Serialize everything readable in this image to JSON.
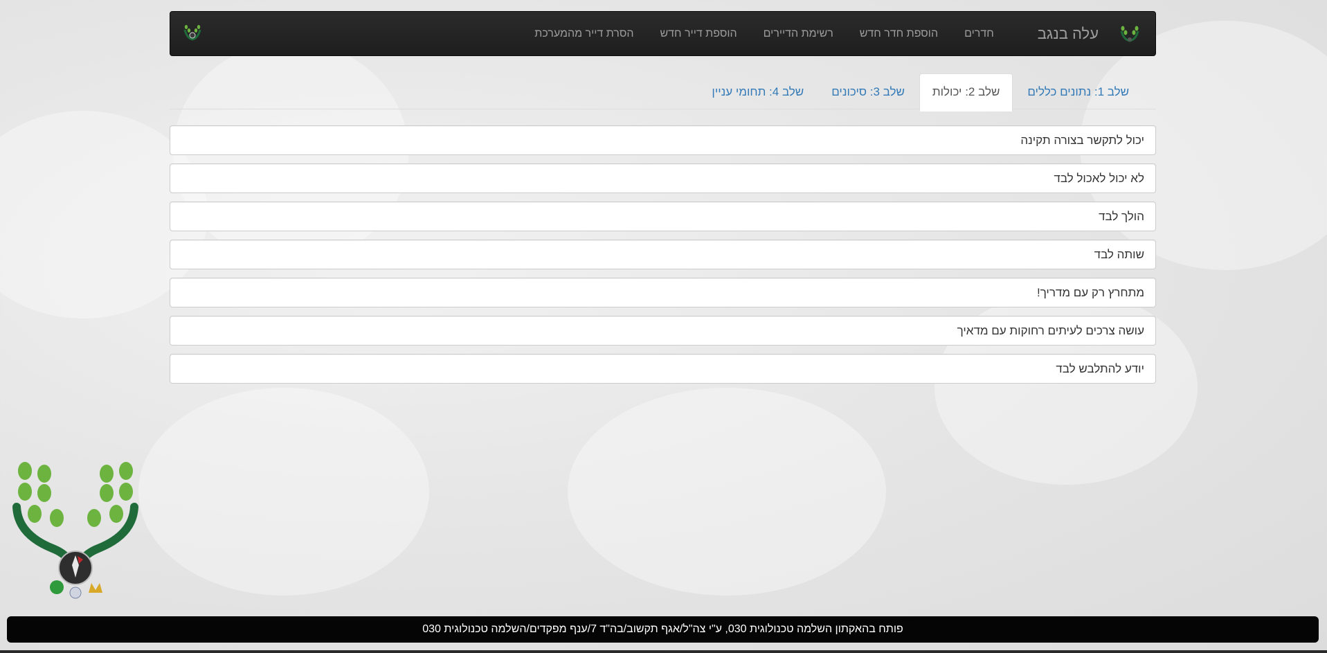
{
  "navbar": {
    "brand_title": "עלה בנגב",
    "links": [
      "חדרים",
      "הוספת חדר חדש",
      "רשימת הדיירים",
      "הוספת דייר חדש",
      "הסרת דייר מהמערכת"
    ]
  },
  "tabs": [
    {
      "label": "שלב 1: נתונים כללים",
      "active": false
    },
    {
      "label": "שלב 2: יכולות",
      "active": true
    },
    {
      "label": "שלב 3: סיכונים",
      "active": false
    },
    {
      "label": "שלב 4: תחומי עניין",
      "active": false
    }
  ],
  "abilities": [
    "יכול לתקשר בצורה תקינה",
    "לא יכול לאכול לבד",
    "הולך לבד",
    "שותה לבד",
    "מתחרץ רק עם מדריך!",
    "עושה צרכים לעיתים רחוקות עם מדאיך",
    "יודע להתלבש לבד"
  ],
  "footer": {
    "text": "פותח בהאקתון השלמה טכנולוגית 030, ע\"י צה\"ל/אגף תקשוב/בה\"ד 7/ענף מפקדים/השלמה טכנולוגית 030"
  },
  "colors": {
    "navbar_bg": "#222222",
    "nav_text": "#9d9d9d",
    "tab_link": "#337ab7",
    "leaf_green": "#6db33f",
    "hand_green": "#1f6b3a",
    "footer_bg": "#050505"
  },
  "icons": {
    "brand_logo": "leaf-hands-logo-icon",
    "side_logo": "organization-emblem-icon"
  }
}
